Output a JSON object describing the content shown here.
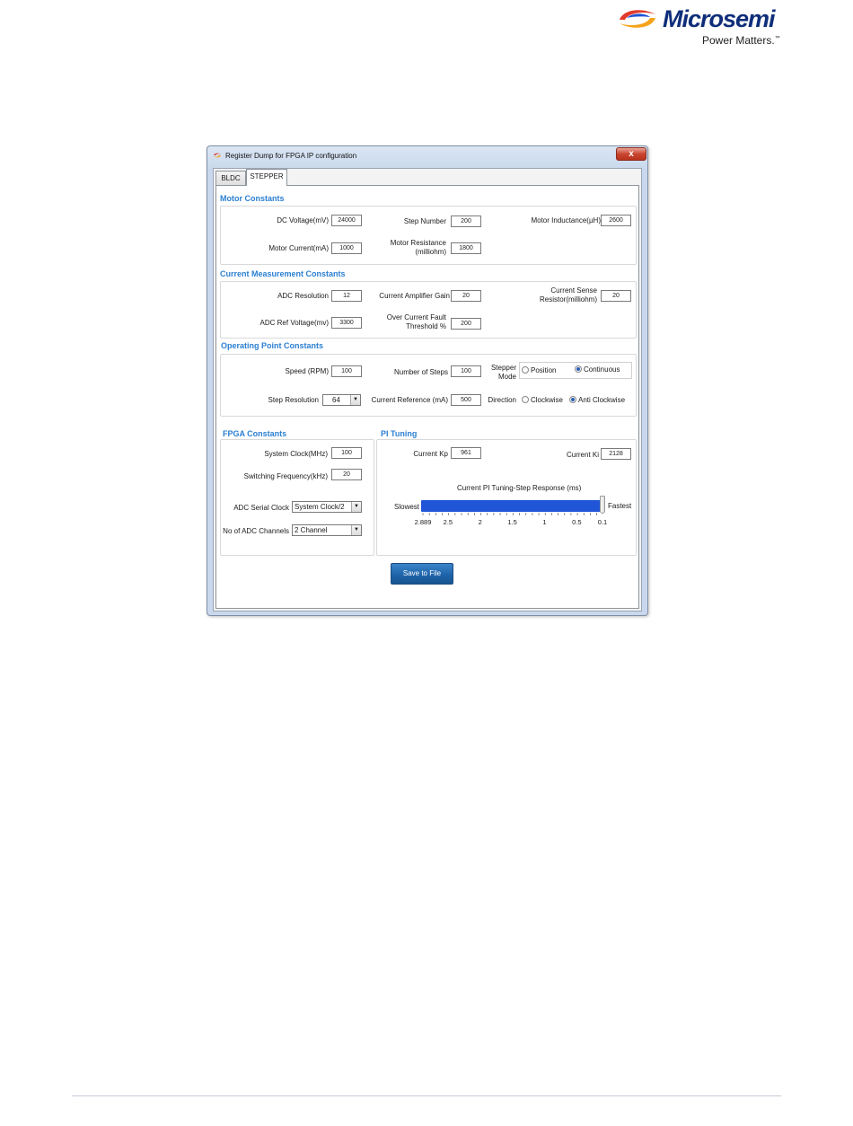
{
  "page": {
    "logo": {
      "brand": "Microsemi",
      "tagline": "Power Matters.",
      "tm": "™"
    }
  },
  "dialog": {
    "title": "Register Dump for FPGA IP configuration",
    "close_label": "x",
    "tabs": [
      {
        "label": "BLDC",
        "active": false
      },
      {
        "label": "STEPPER",
        "active": true
      }
    ]
  },
  "motor_constants": {
    "title": "Motor Constants",
    "dc_voltage": {
      "label": "DC Voltage(mV)",
      "value": "24000"
    },
    "step_number": {
      "label": "Step Number",
      "value": "200"
    },
    "motor_inductance": {
      "label": "Motor Inductance(µH)",
      "value": "2600"
    },
    "motor_current": {
      "label": "Motor Current(mA)",
      "value": "1000"
    },
    "motor_resistance": {
      "label_1": "Motor Resistance",
      "label_2": "(milliohm)",
      "value": "1800"
    }
  },
  "current_measurement": {
    "title": "Current Measurement Constants",
    "adc_resolution": {
      "label": "ADC Resolution",
      "value": "12"
    },
    "amp_gain": {
      "label": "Current Amplifier Gain",
      "value": "20"
    },
    "sense_resistor": {
      "label_1": "Current Sense",
      "label_2": "Resistor(milliohm)",
      "value": "20"
    },
    "adc_ref_voltage": {
      "label": "ADC Ref Voltage(mv)",
      "value": "3300"
    },
    "over_current": {
      "label_1": "Over Current Fault",
      "label_2": "Threshold %",
      "value": "200"
    }
  },
  "operating_point": {
    "title": "Operating Point Constants",
    "speed": {
      "label": "Speed (RPM)",
      "value": "100"
    },
    "num_steps": {
      "label": "Number of Steps",
      "value": "100"
    },
    "stepper_mode": {
      "label_1": "Stepper",
      "label_2": "Mode",
      "options": [
        "Position",
        "Continuous"
      ],
      "selected": "Continuous"
    },
    "step_resolution": {
      "label": "Step Resolution",
      "value": "64"
    },
    "current_reference": {
      "label": "Current Reference (mA)",
      "value": "500"
    },
    "direction": {
      "label": "Direction",
      "options": [
        "Clockwise",
        "Anti Clockwise"
      ],
      "selected": "Anti Clockwise"
    }
  },
  "fpga_constants": {
    "title": "FPGA Constants",
    "system_clock": {
      "label": "System Clock(MHz)",
      "value": "100"
    },
    "switching_freq": {
      "label": "Switching Frequency(kHz)",
      "value": "20"
    },
    "adc_serial_clock": {
      "label": "ADC Serial Clock",
      "value": "System Clock/2"
    },
    "adc_channels": {
      "label": "No of ADC Channels",
      "value": "2 Channel"
    }
  },
  "pi_tuning": {
    "title": "PI Tuning",
    "current_kp": {
      "label": "Current Kp",
      "value": "961"
    },
    "current_ki": {
      "label": "Current Ki",
      "value": "2128"
    },
    "slider": {
      "title": "Current PI Tuning-Step Response (ms)",
      "left_label": "Slowest",
      "right_label": "Fastest",
      "ticks": [
        "2.889",
        "2.5",
        "2",
        "1.5",
        "1",
        "0.5",
        "0.1"
      ],
      "tick_values": [
        2.889,
        2.5,
        2,
        1.5,
        1,
        0.5,
        0.1
      ],
      "min": 2.889,
      "max": 0.1,
      "value": 0.1
    }
  },
  "save_button": {
    "label": "Save to File"
  },
  "colors": {
    "accent": "#2b7fd1",
    "slider": "#1f55d6",
    "button": "#1f64aa",
    "brand": "#0f2e7a"
  }
}
